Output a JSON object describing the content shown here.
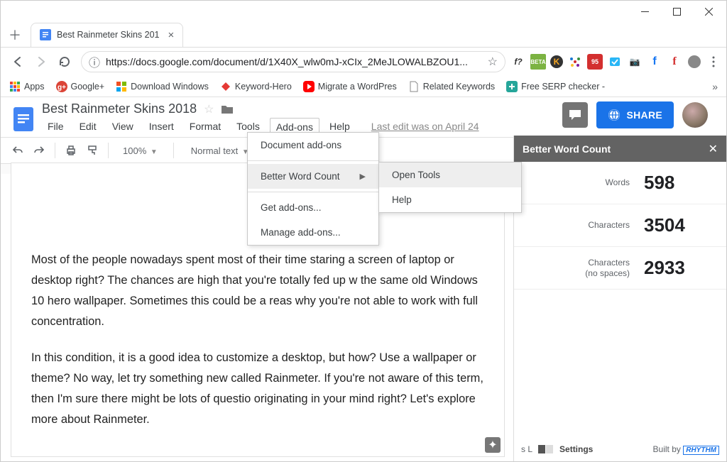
{
  "window": {
    "tab_title": "Best Rainmeter Skins 201"
  },
  "address": {
    "url": "https://docs.google.com/document/d/1X40X_wlw0mJ-xCIx_2MeJLOWALBZOU1..."
  },
  "bookmarks": {
    "apps": "Apps",
    "gplus": "Google+",
    "dlwin": "Download Windows",
    "khero": "Keyword-Hero",
    "migrate": "Migrate a WordPres",
    "related": "Related Keywords",
    "serp": "Free SERP checker -"
  },
  "doc": {
    "title": "Best Rainmeter Skins 2018",
    "last_edit": "Last edit was on April 24",
    "share_label": "SHARE"
  },
  "menus": {
    "file": "File",
    "edit": "Edit",
    "view": "View",
    "insert": "Insert",
    "format": "Format",
    "tools": "Tools",
    "addons": "Add-ons",
    "help": "Help"
  },
  "toolbar": {
    "zoom": "100%",
    "style": "Normal text"
  },
  "addons_menu": {
    "doc_addons": "Document add-ons",
    "bwc": "Better Word Count",
    "get": "Get add-ons...",
    "manage": "Manage add-ons..."
  },
  "submenu": {
    "open_tools": "Open Tools",
    "help": "Help"
  },
  "sidebar": {
    "title": "Better Word Count",
    "words_lbl": "Words",
    "words_val": "598",
    "chars_lbl": "Characters",
    "chars_val": "3504",
    "charsns_lbl": "Characters\n(no spaces)",
    "charsns_val": "2933",
    "sl": "s L",
    "settings": "Settings",
    "builtby": "Built by",
    "rhythm": "RHYTHM"
  },
  "body": {
    "p1": "Most of the people nowadays spent most of their time staring a screen of laptop or desktop right? The chances are high that you're totally fed up w the same old Windows 10 hero wallpaper. Sometimes this could be a reas why you're not able to work with full concentration.",
    "p2": "In this condition, it is a good idea to customize a desktop, but how? Use a wallpaper or theme? No way, let try something new called Rainmeter. If you're not aware of this term, then I'm sure there might be lots of questio originating in your mind right? Let's explore more about Rainmeter."
  }
}
